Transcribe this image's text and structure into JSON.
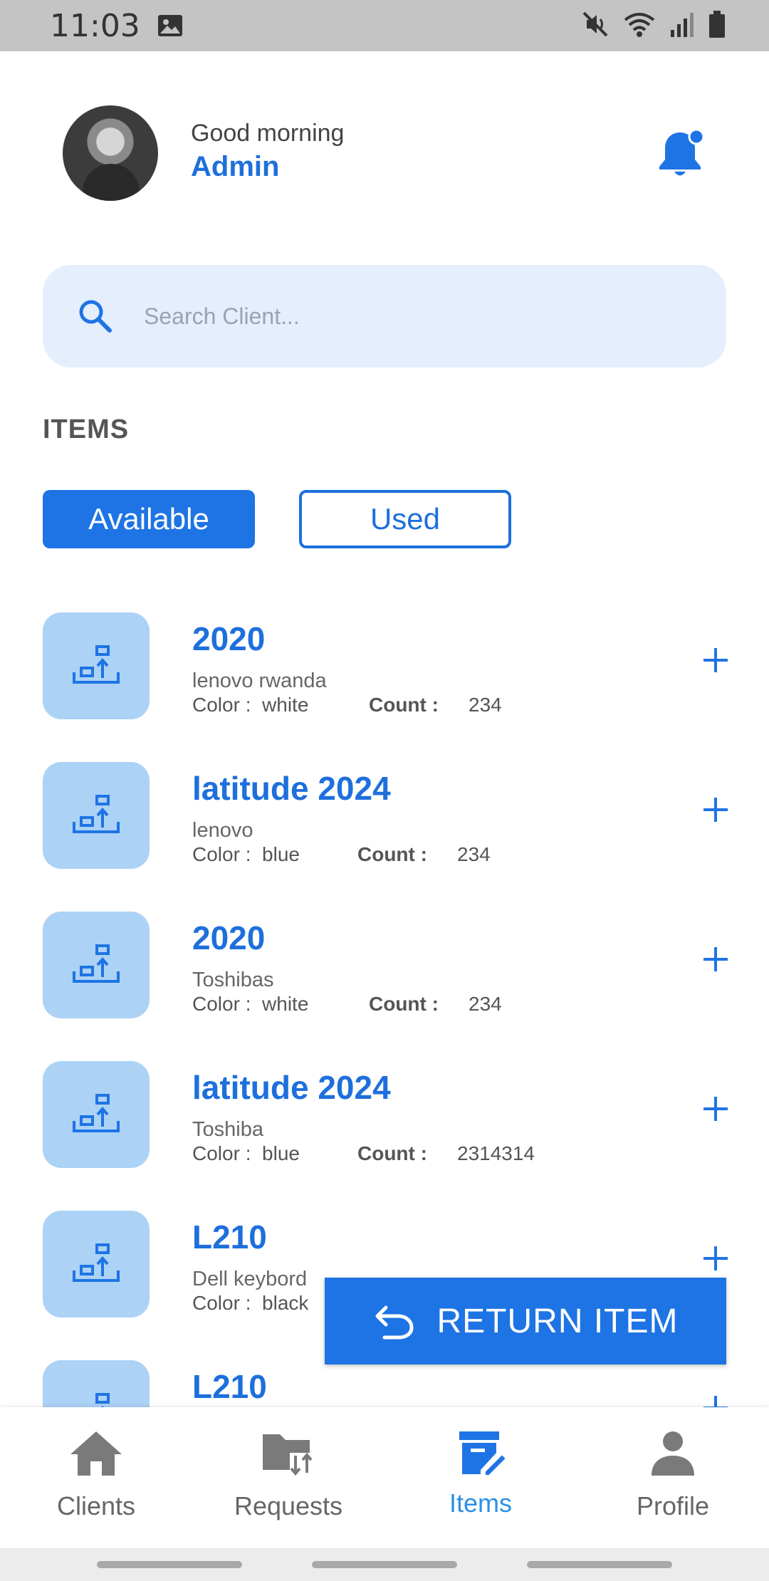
{
  "status_bar": {
    "time": "11:03"
  },
  "header": {
    "greeting": "Good morning",
    "user_name": "Admin"
  },
  "search": {
    "placeholder": "Search Client..."
  },
  "section": {
    "title": "ITEMS"
  },
  "tabs": {
    "available": "Available",
    "used": "Used",
    "selected": "Available"
  },
  "items": [
    {
      "name": "2020",
      "brand": "lenovo rwanda",
      "color_label": "Color :",
      "color": "white",
      "count_label": "Count :",
      "count": "234"
    },
    {
      "name": "latitude 2024",
      "brand": "lenovo",
      "color_label": "Color :",
      "color": "blue",
      "count_label": "Count :",
      "count": "234"
    },
    {
      "name": "2020",
      "brand": "Toshibas",
      "color_label": "Color :",
      "color": "white",
      "count_label": "Count :",
      "count": "234"
    },
    {
      "name": "latitude 2024",
      "brand": "Toshiba",
      "color_label": "Color :",
      "color": "blue",
      "count_label": "Count :",
      "count": "2314314"
    },
    {
      "name": "L210",
      "brand": "Dell keybord",
      "color_label": "Color :",
      "color": "black",
      "count_label": "",
      "count": ""
    },
    {
      "name": "L210",
      "brand": "",
      "color_label": "",
      "color": "",
      "count_label": "",
      "count": ""
    }
  ],
  "return_button": {
    "label": "RETURN ITEM"
  },
  "nav": {
    "items": [
      {
        "label": "Clients",
        "icon": "home-icon"
      },
      {
        "label": "Requests",
        "icon": "folder-swap-icon"
      },
      {
        "label": "Items",
        "icon": "inventory-edit-icon"
      },
      {
        "label": "Profile",
        "icon": "person-icon"
      }
    ],
    "active": "Items"
  },
  "colors": {
    "primary": "#1e74e4",
    "accent_text": "#1e6fdc",
    "thumb_bg": "#acd2f6",
    "search_bg": "#e4eefd",
    "active_nav": "#2b8fe6"
  }
}
